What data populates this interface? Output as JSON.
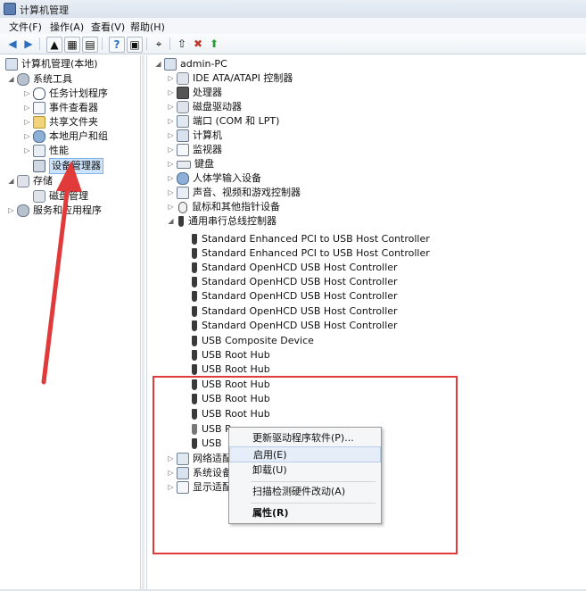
{
  "window": {
    "title": "计算机管理"
  },
  "menu": [
    "文件(F)",
    "操作(A)",
    "查看(V)",
    "帮助(H)"
  ],
  "toolbar_icons": [
    "back-arrow-icon",
    "forward-arrow-icon",
    "up-folder-icon",
    "console-tree-icon",
    "show-hide-icon",
    "help-icon",
    "properties-icon",
    "scan-icon",
    "update-driver-icon",
    "disable-icon",
    "enable-icon"
  ],
  "left_tree": [
    {
      "label": "计算机管理(本地)"
    },
    {
      "label": "系统工具"
    },
    {
      "label": "任务计划程序"
    },
    {
      "label": "事件查看器"
    },
    {
      "label": "共享文件夹"
    },
    {
      "label": "本地用户和组"
    },
    {
      "label": "性能"
    },
    {
      "label": "设备管理器"
    },
    {
      "label": "存储"
    },
    {
      "label": "磁盘管理"
    },
    {
      "label": "服务和应用程序"
    }
  ],
  "device_tree": {
    "root": "admin-PC",
    "categories": [
      "IDE ATA/ATAPI 控制器",
      "处理器",
      "磁盘驱动器",
      "端口 (COM 和 LPT)",
      "计算机",
      "监视器",
      "键盘",
      "人体学输入设备",
      "声音、视频和游戏控制器",
      "鼠标和其他指针设备",
      "通用串行总线控制器"
    ],
    "usb_devices": [
      "Standard Enhanced PCI to USB Host Controller",
      "Standard Enhanced PCI to USB Host Controller",
      "Standard OpenHCD USB Host Controller",
      "Standard OpenHCD USB Host Controller",
      "Standard OpenHCD USB Host Controller",
      "Standard OpenHCD USB Host Controller",
      "Standard OpenHCD USB Host Controller",
      "USB Composite Device",
      "USB Root Hub",
      "USB Root Hub",
      "USB Root Hub",
      "USB Root Hub",
      "USB Root Hub",
      "USB R",
      "USB"
    ],
    "after": [
      "网络适配",
      "系统设备",
      "显示适配"
    ]
  },
  "context_menu": [
    {
      "label": "更新驱动程序软件(P)..."
    },
    {
      "label": "启用(E)"
    },
    {
      "label": "卸载(U)"
    },
    {
      "label": "扫描检测硬件改动(A)"
    },
    {
      "label": "属性(R)"
    }
  ],
  "colors": {
    "highlight_box": "#e03a3a",
    "arrow": "#e03a3a",
    "selection": "#cde3fb"
  }
}
